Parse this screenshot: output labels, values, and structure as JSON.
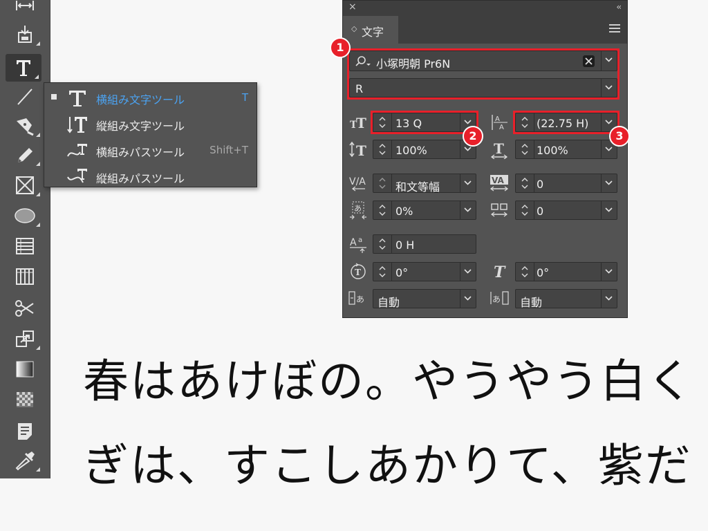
{
  "toolbar": {
    "tools": [
      {
        "name": "gap-tool",
        "icon": "gap-icon"
      },
      {
        "name": "content-placer-tool",
        "icon": "content-placer-icon"
      },
      {
        "name": "type-tool",
        "icon": "type-icon",
        "active": true
      },
      {
        "name": "line-tool",
        "icon": "line-icon"
      },
      {
        "name": "pen-tool",
        "icon": "pen-icon"
      },
      {
        "name": "pencil-tool",
        "icon": "pencil-icon"
      },
      {
        "name": "rectangle-frame-tool",
        "icon": "rectangle-frame-icon"
      },
      {
        "name": "ellipse-tool",
        "icon": "ellipse-icon"
      },
      {
        "name": "horizontal-grid-tool",
        "icon": "horizontal-grid-icon"
      },
      {
        "name": "vertical-grid-tool",
        "icon": "vertical-grid-icon"
      },
      {
        "name": "scissors-tool",
        "icon": "scissors-icon"
      },
      {
        "name": "free-transform-tool",
        "icon": "free-transform-icon"
      },
      {
        "name": "gradient-tool",
        "icon": "gradient-icon"
      },
      {
        "name": "gradient-feather-tool",
        "icon": "gradient-feather-icon"
      },
      {
        "name": "note-tool",
        "icon": "note-icon"
      },
      {
        "name": "eyedropper-tool",
        "icon": "eyedropper-icon"
      }
    ]
  },
  "flyout": {
    "items": [
      {
        "label": "横組み文字ツール",
        "shortcut": "T",
        "selected": true
      },
      {
        "label": "縦組み文字ツール",
        "shortcut": ""
      },
      {
        "label": "横組みパスツール",
        "shortcut": "Shift+T"
      },
      {
        "label": "縦組みパスツール",
        "shortcut": ""
      }
    ]
  },
  "panel": {
    "close_glyph": "×",
    "collapse_glyph": "‹‹",
    "tab_icon": "◇",
    "tab_label": "文字",
    "font_family": "小塚明朝 Pr6N",
    "font_style": "R",
    "font_size": "13 Q",
    "leading": "(22.75 H)",
    "vertical_scale": "100%",
    "horizontal_scale": "100%",
    "kerning": "和文等幅",
    "tracking": "0",
    "tsume": "0%",
    "mojikumi_aki": "0",
    "baseline_shift": "0 H",
    "character_rotation": "0°",
    "skew": "0°",
    "aki_before": "自動",
    "aki_after": "自動"
  },
  "annotations": {
    "badge1": "1",
    "badge2": "2",
    "badge3": "3",
    "color": "#e8202a"
  },
  "document": {
    "line1": "春はあけぼの。やうやう白く",
    "line2": "ぎは、すこしあかりて、紫だ"
  }
}
